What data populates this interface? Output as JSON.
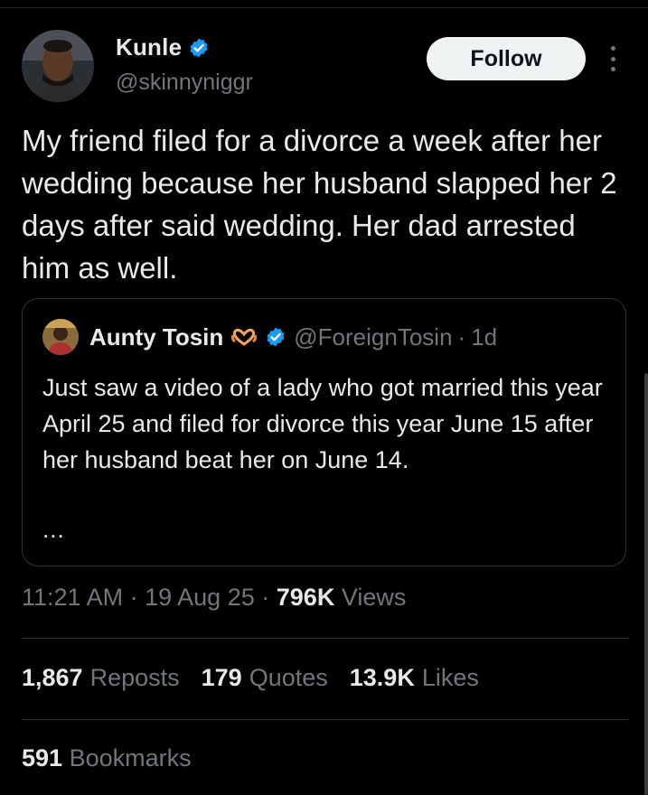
{
  "author": {
    "name": "Kunle",
    "handle": "@skinnyniggr",
    "verified": true
  },
  "follow_label": "Follow",
  "tweet_text": "My friend filed for a divorce a week after her wedding because her husband slapped her 2 days after said wedding. Her dad arrested him as well.",
  "quote": {
    "name": "Aunty Tosin",
    "handle": "@ForeignTosin",
    "separator": "·",
    "age": "1d",
    "text": "Just saw a video of a lady who got married this year April 25 and filed for divorce this year June 15 after her husband beat her on June 14.",
    "ellipsis": "..."
  },
  "meta": {
    "time": "11:21 AM",
    "sep1": "·",
    "date": "19 Aug 25",
    "sep2": "·",
    "views_count": "796K",
    "views_label": "Views"
  },
  "stats": {
    "reposts_count": "1,867",
    "reposts_label": "Reposts",
    "quotes_count": "179",
    "quotes_label": "Quotes",
    "likes_count": "13.9K",
    "likes_label": "Likes",
    "bookmarks_count": "591",
    "bookmarks_label": "Bookmarks"
  },
  "colors": {
    "background": "#000000",
    "text": "#e7e9ea",
    "muted": "#71767b",
    "verified": "#1d9bf0",
    "border": "#2f3336"
  },
  "icons": {
    "verified": "verified-badge-icon",
    "more": "more-vertical-icon",
    "heart_hands": "heart-hands-emoji-icon"
  }
}
